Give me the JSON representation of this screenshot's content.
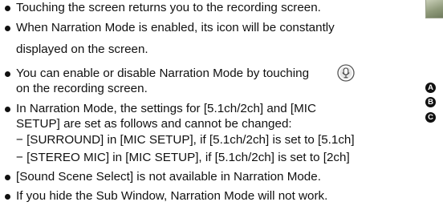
{
  "bullets": [
    {
      "text": "Touching the screen returns you to the recording screen."
    },
    {
      "text": "When Narration Mode is enabled, its icon will be constantly"
    },
    {
      "text": "displayed on the screen."
    },
    {
      "text_before": "You can enable or disable Narration Mode by touching",
      "icon": "narration-mic-icon"
    },
    {
      "text": "on the recording screen."
    },
    {
      "text": "In Narration Mode, the settings for [5.1ch/2ch] and [MIC"
    },
    {
      "text": "SETUP] are set as follows and cannot be changed:"
    },
    {
      "text": "−  [SURROUND] in [MIC SETUP], if [5.1ch/2ch] is set to [5.1ch]"
    },
    {
      "text": "−  [STEREO MIC] in [MIC SETUP], if [5.1ch/2ch] is set to [2ch]"
    },
    {
      "text": "[Sound Scene Select] is not available in Narration Mode."
    },
    {
      "text": "If you hide the Sub Window, Narration Mode will not work."
    }
  ],
  "side_markers": [
    "A",
    "B",
    "C"
  ],
  "colors": {
    "text": "#111111",
    "marker_bg": "#111111",
    "marker_fg": "#ffffff"
  }
}
